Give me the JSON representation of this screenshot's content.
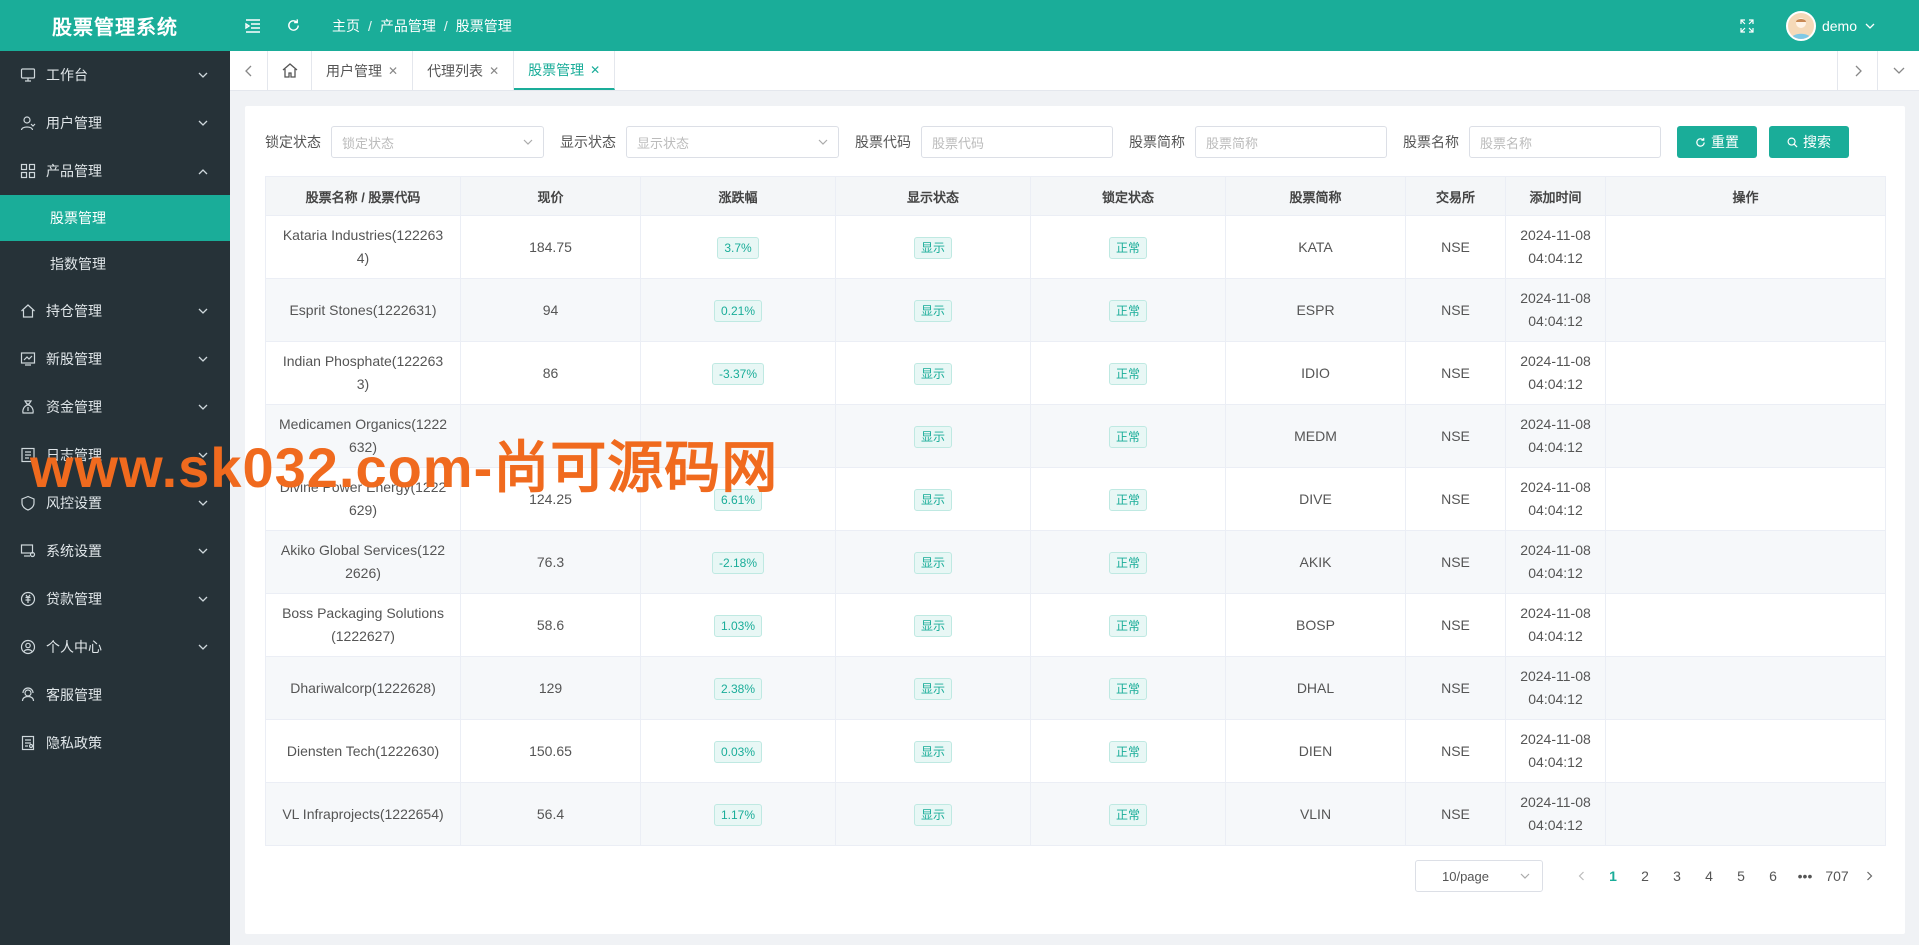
{
  "app": {
    "title": "股票管理系统"
  },
  "sidebar": {
    "items": [
      {
        "label": "工作台",
        "icon": "monitor-icon"
      },
      {
        "label": "用户管理",
        "icon": "user-icon"
      },
      {
        "label": "产品管理",
        "icon": "grid-icon",
        "expanded": true,
        "children": [
          {
            "label": "股票管理",
            "active": true
          },
          {
            "label": "指数管理"
          }
        ]
      },
      {
        "label": "持仓管理",
        "icon": "home-icon"
      },
      {
        "label": "新股管理",
        "icon": "chart-icon"
      },
      {
        "label": "资金管理",
        "icon": "money-bag-icon"
      },
      {
        "label": "日志管理",
        "icon": "log-icon"
      },
      {
        "label": "风控设置",
        "icon": "shield-icon"
      },
      {
        "label": "系统设置",
        "icon": "settings-monitor-icon"
      },
      {
        "label": "贷款管理",
        "icon": "loan-icon"
      },
      {
        "label": "个人中心",
        "icon": "person-circle-icon"
      },
      {
        "label": "客服管理",
        "icon": "headset-icon"
      },
      {
        "label": "隐私政策",
        "icon": "document-icon"
      }
    ]
  },
  "header": {
    "breadcrumb": [
      "主页",
      "产品管理",
      "股票管理"
    ],
    "username": "demo"
  },
  "tabs": [
    {
      "label": "用户管理",
      "active": false
    },
    {
      "label": "代理列表",
      "active": false
    },
    {
      "label": "股票管理",
      "active": true
    }
  ],
  "filters": {
    "lock": {
      "label": "锁定状态",
      "placeholder": "锁定状态"
    },
    "show": {
      "label": "显示状态",
      "placeholder": "显示状态"
    },
    "code": {
      "label": "股票代码",
      "placeholder": "股票代码"
    },
    "short": {
      "label": "股票简称",
      "placeholder": "股票简称"
    },
    "name": {
      "label": "股票名称",
      "placeholder": "股票名称"
    },
    "reset_label": "重置",
    "search_label": "搜索"
  },
  "table": {
    "headers": [
      "股票名称 / 股票代码",
      "现价",
      "涨跌幅",
      "显示状态",
      "锁定状态",
      "股票简称",
      "交易所",
      "添加时间",
      "操作"
    ],
    "rows": [
      {
        "name": "Kataria Industries(122263",
        "name2": "4)",
        "price": "184.75",
        "change": "3.7%",
        "show": "显示",
        "lock": "正常",
        "short": "KATA",
        "exchange": "NSE",
        "date": "2024-11-08",
        "time": "04:04:12"
      },
      {
        "name": "Esprit Stones(1222631)",
        "name2": "",
        "price": "94",
        "change": "0.21%",
        "show": "显示",
        "lock": "正常",
        "short": "ESPR",
        "exchange": "NSE",
        "date": "2024-11-08",
        "time": "04:04:12"
      },
      {
        "name": "Indian Phosphate(122263",
        "name2": "3)",
        "price": "86",
        "change": "-3.37%",
        "show": "显示",
        "lock": "正常",
        "short": "IDIO",
        "exchange": "NSE",
        "date": "2024-11-08",
        "time": "04:04:12"
      },
      {
        "name": "Medicamen Organics(1222",
        "name2": "632)",
        "price": "",
        "change": "",
        "show": "显示",
        "lock": "正常",
        "short": "MEDM",
        "exchange": "NSE",
        "date": "2024-11-08",
        "time": "04:04:12"
      },
      {
        "name": "Divine Power Energy(1222",
        "name2": "629)",
        "price": "124.25",
        "change": "6.61%",
        "show": "显示",
        "lock": "正常",
        "short": "DIVE",
        "exchange": "NSE",
        "date": "2024-11-08",
        "time": "04:04:12"
      },
      {
        "name": "Akiko Global Services(122",
        "name2": "2626)",
        "price": "76.3",
        "change": "-2.18%",
        "show": "显示",
        "lock": "正常",
        "short": "AKIK",
        "exchange": "NSE",
        "date": "2024-11-08",
        "time": "04:04:12"
      },
      {
        "name": "Boss Packaging Solutions",
        "name2": "(1222627)",
        "price": "58.6",
        "change": "1.03%",
        "show": "显示",
        "lock": "正常",
        "short": "BOSP",
        "exchange": "NSE",
        "date": "2024-11-08",
        "time": "04:04:12"
      },
      {
        "name": "Dhariwalcorp(1222628)",
        "name2": "",
        "price": "129",
        "change": "2.38%",
        "show": "显示",
        "lock": "正常",
        "short": "DHAL",
        "exchange": "NSE",
        "date": "2024-11-08",
        "time": "04:04:12"
      },
      {
        "name": "Diensten Tech(1222630)",
        "name2": "",
        "price": "150.65",
        "change": "0.03%",
        "show": "显示",
        "lock": "正常",
        "short": "DIEN",
        "exchange": "NSE",
        "date": "2024-11-08",
        "time": "04:04:12"
      },
      {
        "name": "VL Infraprojects(1222654)",
        "name2": "",
        "price": "56.4",
        "change": "1.17%",
        "show": "显示",
        "lock": "正常",
        "short": "VLIN",
        "exchange": "NSE",
        "date": "2024-11-08",
        "time": "04:04:12"
      }
    ]
  },
  "pagination": {
    "page_size": "10/page",
    "pages": [
      "1",
      "2",
      "3",
      "4",
      "5",
      "6"
    ],
    "ellipsis": "•••",
    "last": "707",
    "current": "1"
  },
  "watermark": "www.sk032.com-尚可源码网",
  "colors": {
    "brand": "#1aad99",
    "sidebar": "#263238",
    "watermark": "#f06a1e"
  }
}
